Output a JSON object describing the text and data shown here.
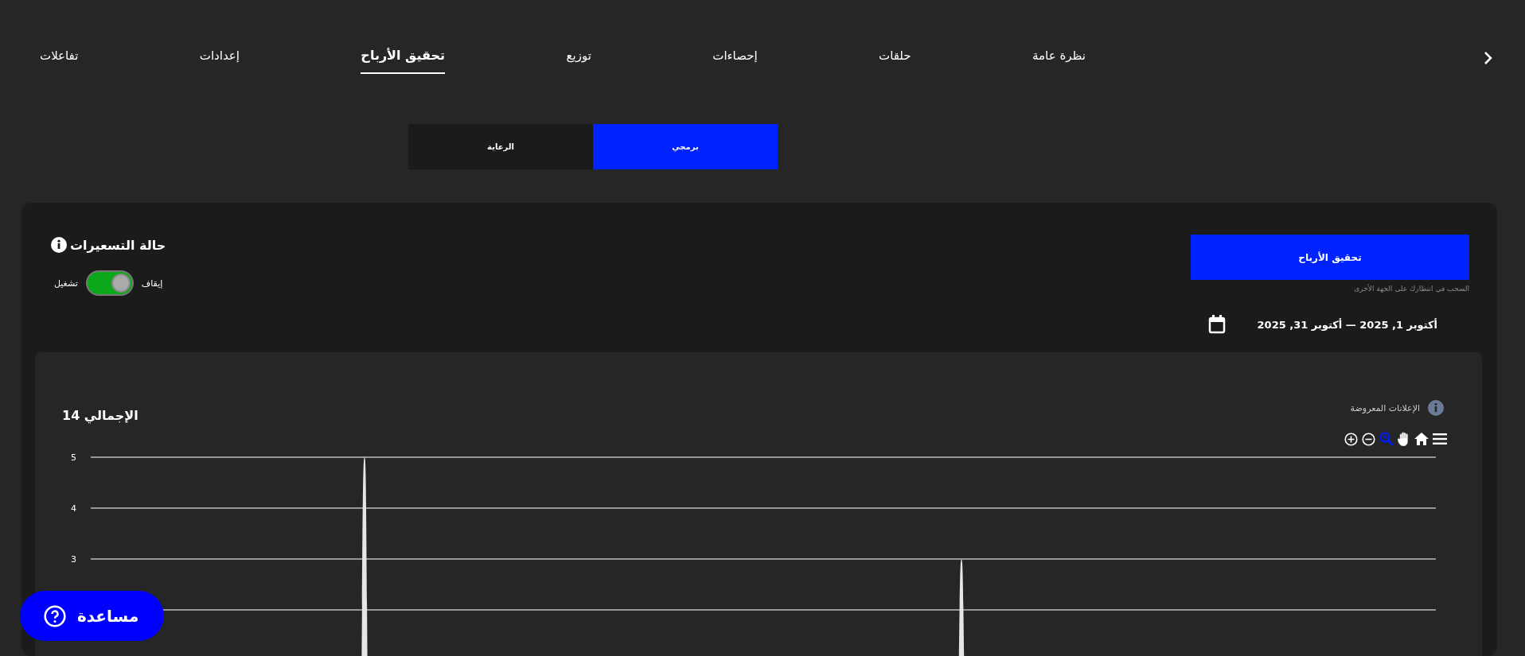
{
  "nav": {
    "tabs": [
      {
        "label": "نظرة عامة",
        "selected": false
      },
      {
        "label": "حلقات",
        "selected": false
      },
      {
        "label": "إحصاءات",
        "selected": false
      },
      {
        "label": "توزيع",
        "selected": false
      },
      {
        "label": "تحقيق الأرباح",
        "selected": true
      },
      {
        "label": "إعدادات",
        "selected": false
      },
      {
        "label": "تفاعلات",
        "selected": false
      }
    ]
  },
  "segments": [
    {
      "label": "برمجي",
      "selected": true
    },
    {
      "label": "الرعاية",
      "selected": false
    }
  ],
  "card": {
    "monetize_button": "تحقيق الأرباح",
    "monetize_caption": "السحب في انتظارك على الجهة الأخرى",
    "date_range": "أكتوبر 1, 2025 — أكتوبر 31, 2025",
    "pricing": {
      "title": "حالة التسعيرات",
      "off_label": "إيقاف",
      "on_label": "تشغيل",
      "on": true
    },
    "chart_panel": {
      "metric": "الإعلانات المعروضة",
      "total": "الإجمالي 14",
      "y_axis_labels": [
        "5",
        "4",
        "3"
      ]
    }
  },
  "help_button": "مساعدة"
}
